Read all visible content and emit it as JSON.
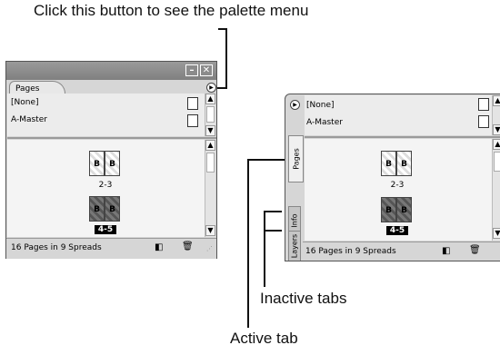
{
  "callouts": {
    "top": "Click this button to see the palette menu",
    "inactive": "Inactive tabs",
    "active": "Active tab"
  },
  "left_palette": {
    "window_buttons": {
      "minimize": "–",
      "close": "✕"
    },
    "tab_label": "Pages",
    "menu_icon": "palette-menu-icon",
    "masters": [
      "[None]",
      "A-Master"
    ],
    "spreads": [
      {
        "pages": [
          "B",
          "B"
        ],
        "label": "2-3",
        "selected": false
      },
      {
        "pages": [
          "B",
          "B"
        ],
        "label": "4-5",
        "selected": true
      }
    ],
    "status_text": "16 Pages in 9 Spreads"
  },
  "right_palette": {
    "masters": [
      "[None]",
      "A-Master"
    ],
    "tabs": [
      "Pages",
      "Info",
      "Layers"
    ],
    "spreads": [
      {
        "pages": [
          "B",
          "B"
        ],
        "label": "2-3",
        "selected": false
      },
      {
        "pages": [
          "B",
          "B"
        ],
        "label": "4-5",
        "selected": true
      }
    ],
    "status_text": "16 Pages in 9 Spreads"
  }
}
